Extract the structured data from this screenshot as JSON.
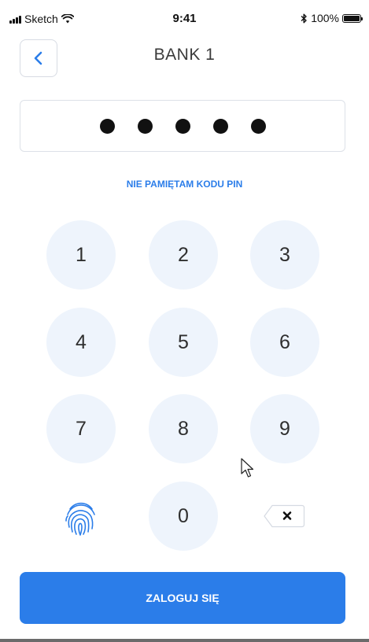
{
  "status_bar": {
    "carrier": "Sketch",
    "time": "9:41",
    "battery": "100%",
    "icons": [
      "signal-icon",
      "wifi-icon",
      "bluetooth-icon",
      "battery-icon"
    ]
  },
  "header": {
    "back_icon": "chevron-left-icon",
    "title": "BANK 1"
  },
  "pin": {
    "filled_count": 5
  },
  "forgot_pin_label": "NIE PAMIĘTAM KODU PIN",
  "keypad": {
    "keys": [
      "1",
      "2",
      "3",
      "4",
      "5",
      "6",
      "7",
      "8",
      "9",
      "0"
    ],
    "fingerprint_icon": "fingerprint-icon",
    "delete_icon": "backspace-icon"
  },
  "login_label": "ZALOGUJ SIĘ",
  "colors": {
    "accent": "#2b7de9",
    "key_background": "#eef4fc",
    "text": "#333333"
  }
}
